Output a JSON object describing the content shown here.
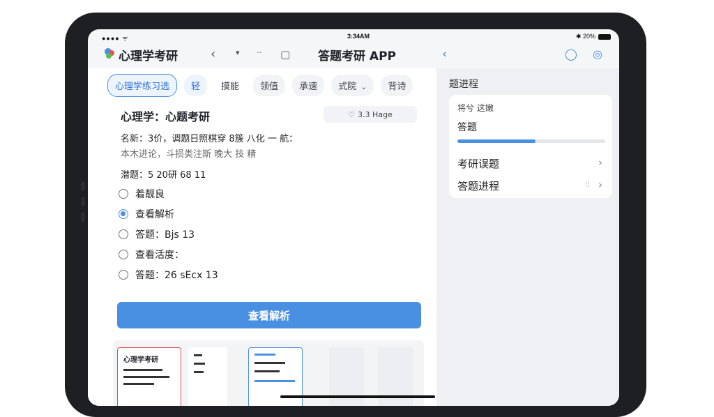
{
  "status": {
    "signal": "●●●● ᯤ",
    "time": "3:34AM",
    "battery_text": "✱ 20%"
  },
  "navbar": {
    "app_title": "心理学考研",
    "center_title": "答题考研 APP",
    "icons": [
      "chevron-left-icon",
      "chevron-down-icon",
      "more-dots-icon",
      "chat-bubble-icon",
      "back-icon",
      "circle-icon",
      "camera-icon"
    ]
  },
  "tabs": [
    {
      "label": "心理学练习选",
      "state": "active"
    },
    {
      "label": "轻",
      "state": "blue"
    },
    {
      "label": "摸能",
      "state": "plain"
    },
    {
      "label": "领值",
      "state": "light"
    },
    {
      "label": "承速",
      "state": "light"
    },
    {
      "label": "式院",
      "state": "light",
      "dropdown": true
    },
    {
      "label": "背诗",
      "state": "light"
    }
  ],
  "question": {
    "title": "心理学：心题考研",
    "like_text": "3.3 Hage",
    "meta_line1": "名新：3价，调题日照棋穿 8簇 八化 一 航：",
    "meta_line2": "本木进论，斗损类注斯  晚大 技 精",
    "stem": "潜题：5 20研 68 11"
  },
  "options": [
    {
      "label": "着靓良",
      "selected": false
    },
    {
      "label": "查看解析",
      "selected": true
    },
    {
      "label": "答题：Bjs 13",
      "selected": false
    },
    {
      "label": "查看活度：",
      "selected": false
    },
    {
      "label": "答题：26 sEcx 13",
      "selected": false
    }
  ],
  "primary_button": "查看解析",
  "thumbnails": {
    "first_title": "心理学考研"
  },
  "right_pane": {
    "header": "题进程",
    "card_sub": "将兮 这嫩",
    "progress_label": "答题",
    "progress_value": 0.53,
    "row1": "考研误题",
    "row2": "答题进程"
  },
  "colors": {
    "accent": "#4a90e2",
    "page_bg": "#f5f6f8"
  }
}
